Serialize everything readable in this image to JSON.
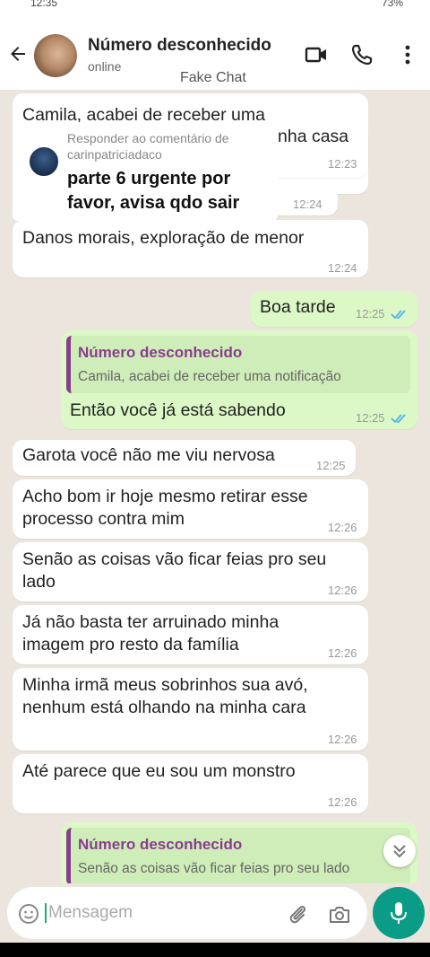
{
  "statusbar": {
    "time": "12:35",
    "battery": "73%"
  },
  "header": {
    "contact_name": "Número desconhecido",
    "contact_status": "online",
    "overlay_label": "Fake Chat"
  },
  "overlay": {
    "reply_label": "Responder ao comentário de",
    "reply_user": "carinpatriciadaco",
    "line1": "parte 6 urgente por",
    "line2": "favor, avisa qdo sair"
  },
  "messages": [
    {
      "dir": "in",
      "lines": [
        "Camila, acabei de receber uma"
      ],
      "time": ""
    },
    {
      "dir": "in",
      "lines": [
        "nha casa"
      ],
      "time": "12:23"
    },
    {
      "dir": "in",
      "lines": [
        ""
      ],
      "time": "12:24"
    },
    {
      "dir": "in",
      "lines": [
        "Danos morais, exploração de menor"
      ],
      "time": "12:24"
    },
    {
      "dir": "out",
      "lines": [
        "Boa tarde"
      ],
      "time": "12:25"
    },
    {
      "dir": "out",
      "quote_name": "Número desconhecido",
      "quote_text": "Camila, acabei de receber uma notificação",
      "lines": [
        "Então você já está sabendo"
      ],
      "time": "12:25"
    },
    {
      "dir": "in",
      "lines": [
        "Garota você não me viu nervosa"
      ],
      "time": "12:25"
    },
    {
      "dir": "in",
      "lines": [
        "Acho bom ir hoje mesmo retirar esse",
        "processo contra mim"
      ],
      "time": "12:26"
    },
    {
      "dir": "in",
      "lines": [
        "Senão as coisas vão ficar feias pro seu",
        "lado"
      ],
      "time": "12:26"
    },
    {
      "dir": "in",
      "lines": [
        "Já não basta ter arruinado minha",
        "imagem pro resto da família"
      ],
      "time": "12:26"
    },
    {
      "dir": "in",
      "lines": [
        "Minha irmã meus sobrinhos sua avó,",
        "nenhum está olhando na minha cara"
      ],
      "time": "12:26"
    },
    {
      "dir": "in",
      "lines": [
        "Até parece que eu sou um monstro"
      ],
      "time": "12:26"
    },
    {
      "dir": "out",
      "quote_name": "Número desconhecido",
      "quote_text": "Senão as coisas vão ficar feias pro seu lado",
      "lines": [],
      "time": ""
    }
  ],
  "composer": {
    "placeholder": "Mensagem"
  },
  "colors": {
    "outgoing": "#dcf8c6",
    "incoming": "#ffffff",
    "quote_accent": "#8a3d8f",
    "mic": "#0a9c86",
    "read_ticks": "#4fb6ec"
  }
}
